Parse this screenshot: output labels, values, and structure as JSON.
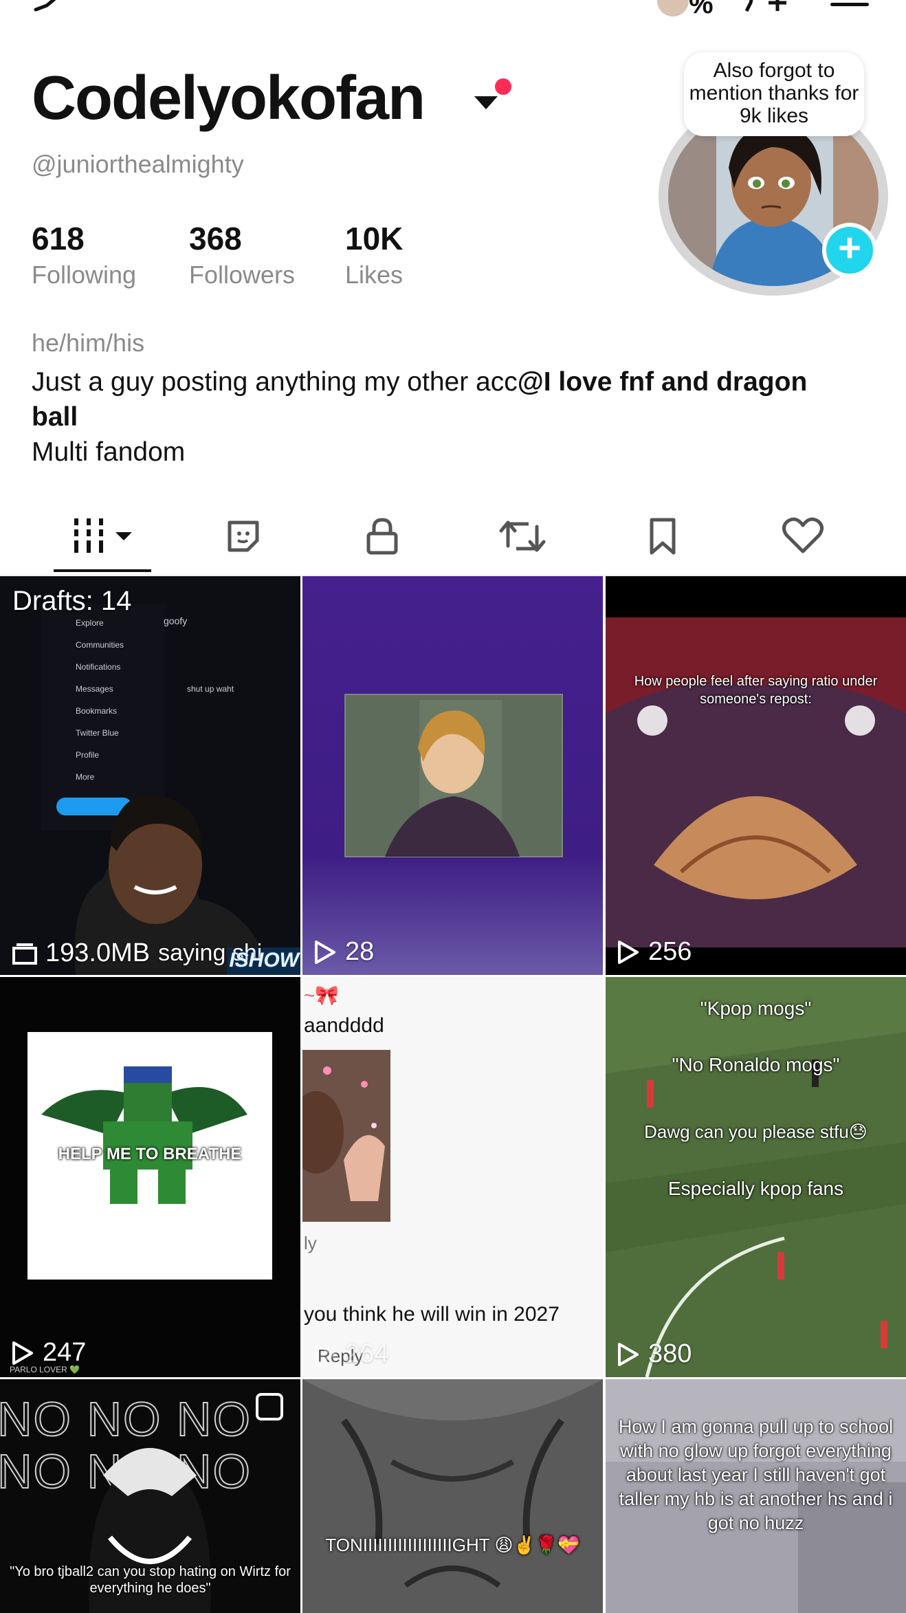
{
  "topbar": {
    "percent": "%"
  },
  "profile": {
    "display_name": "Codelyokofan",
    "handle": "@juniorthealmighty",
    "stats": [
      {
        "value": "618",
        "label": "Following"
      },
      {
        "value": "368",
        "label": "Followers"
      },
      {
        "value": "10K",
        "label": "Likes"
      }
    ],
    "pronouns": "he/him/his",
    "bio_plain": "Just a guy posting anything my other acc",
    "bio_bold": "@I love fnf and dragon ball",
    "bio_line2": "Multi fandom",
    "note_bubble": "Also forgot to mention thanks for 9k likes"
  },
  "tabs": [
    {
      "name": "videos",
      "icon": "grid-bars-icon"
    },
    {
      "name": "favorites-stickers",
      "icon": "sticker-icon"
    },
    {
      "name": "private",
      "icon": "lock-icon"
    },
    {
      "name": "reposts",
      "icon": "repost-icon"
    },
    {
      "name": "saved",
      "icon": "bookmark-icon"
    },
    {
      "name": "liked",
      "icon": "heart-icon"
    }
  ],
  "grid": [
    {
      "kind": "drafts",
      "label": "Drafts: 14",
      "size": "193.0MB",
      "overlay_text": "saying shi",
      "watermark": "ISHOW"
    },
    {
      "kind": "video",
      "views": "28"
    },
    {
      "kind": "video",
      "views": "256",
      "caption": "How people feel after saying ratio under someone's repost:"
    },
    {
      "kind": "video",
      "views": "247",
      "caption": "HELP ME TO BREATHE",
      "footer_text": "PARLO LOVER 💚"
    },
    {
      "kind": "video",
      "views": "264",
      "top_text": "aandddd",
      "caption": "you think he will win in 2027",
      "reply_text": "Reply",
      "side_text": "ly"
    },
    {
      "kind": "video",
      "views": "380",
      "lines": [
        "\"Kpop mogs\"",
        "\"No Ronaldo mogs\"",
        "Dawg can you please stfu😓",
        "Especially kpop fans"
      ]
    },
    {
      "kind": "video",
      "caption": "\"Yo bro tjball2 can you stop hating on Wirtz for everything he does\"",
      "bg_text": "NO NO NO"
    },
    {
      "kind": "video",
      "caption": "TONIIIIIIIIIIIIIIIIIIGHT 😩✌️🌹💝"
    },
    {
      "kind": "video",
      "caption": "How I am gonna pull up to school with no glow up forgot everything about last year I still haven't got taller my hb is at another hs and i got no huzz"
    }
  ],
  "colors": {
    "accent_red": "#fe2c55",
    "accent_cyan": "#20d5ec",
    "muted": "#8a8a8a"
  }
}
